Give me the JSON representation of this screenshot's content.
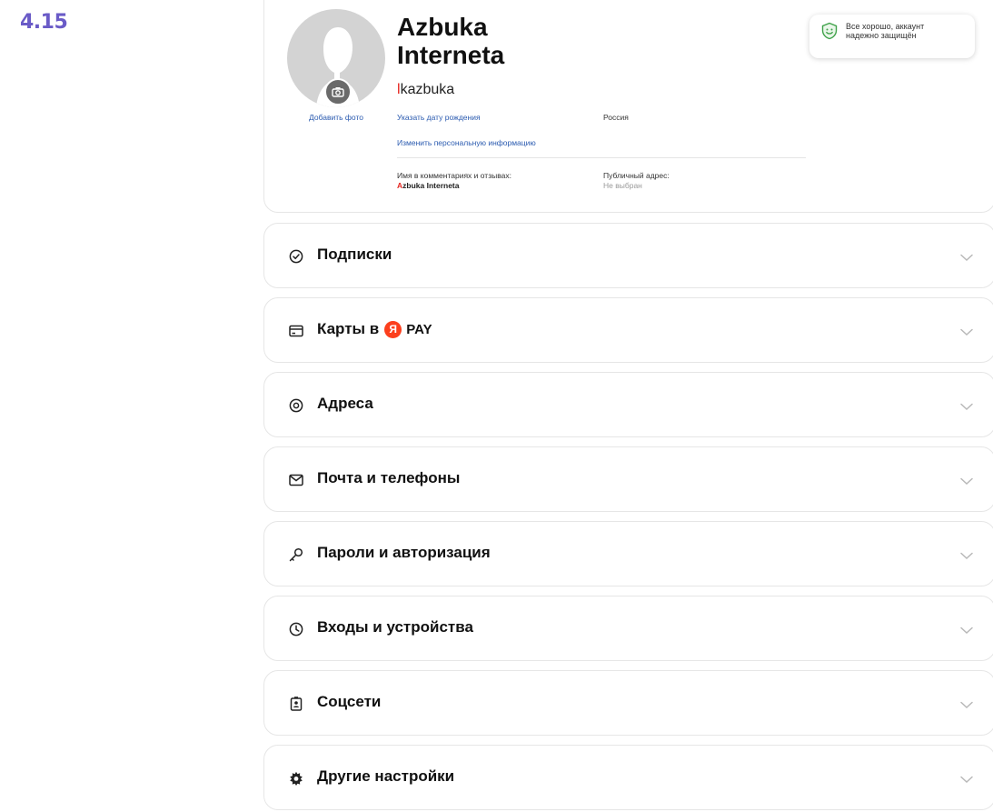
{
  "figure_label": "4.15",
  "profile": {
    "first_name": "Azbuka",
    "last_name": "Interneta",
    "login_first": "l",
    "login_rest": "kazbuka",
    "add_photo": "Добавить фото",
    "birthday_link": "Указать дату рождения",
    "country": "Россия",
    "edit_personal_link": "Изменить персональную информацию",
    "comments_name_label": "Имя в комментариях и отзывах:",
    "comments_name_first": "A",
    "comments_name_rest": "zbuka Interneta",
    "public_address_label": "Публичный адрес:",
    "public_address_value": "Не выбран"
  },
  "security": {
    "text": "Все хорошо, аккаунт надежно защищён",
    "color": "#3fa24a"
  },
  "sections": [
    {
      "label": "Подписки",
      "icon": "check-circle-icon"
    },
    {
      "label": "Карты в",
      "suffix_logo_letter": "Я",
      "suffix_text": "PAY",
      "icon": "card-icon"
    },
    {
      "label": "Адреса",
      "icon": "location-pin-icon"
    },
    {
      "label": "Почта и телефоны",
      "icon": "envelope-icon"
    },
    {
      "label": "Пароли и авторизация",
      "icon": "key-icon"
    },
    {
      "label": "Входы и устройства",
      "icon": "clock-icon"
    },
    {
      "label": "Соцсети",
      "icon": "id-badge-icon"
    },
    {
      "label": "Другие настройки",
      "icon": "gear-icon"
    }
  ],
  "colors": {
    "accent_purple": "#6a5bc7",
    "link_blue": "#2b5bb0",
    "yandex_red": "#fc3f1d",
    "chevron": "#b8b8b8"
  }
}
